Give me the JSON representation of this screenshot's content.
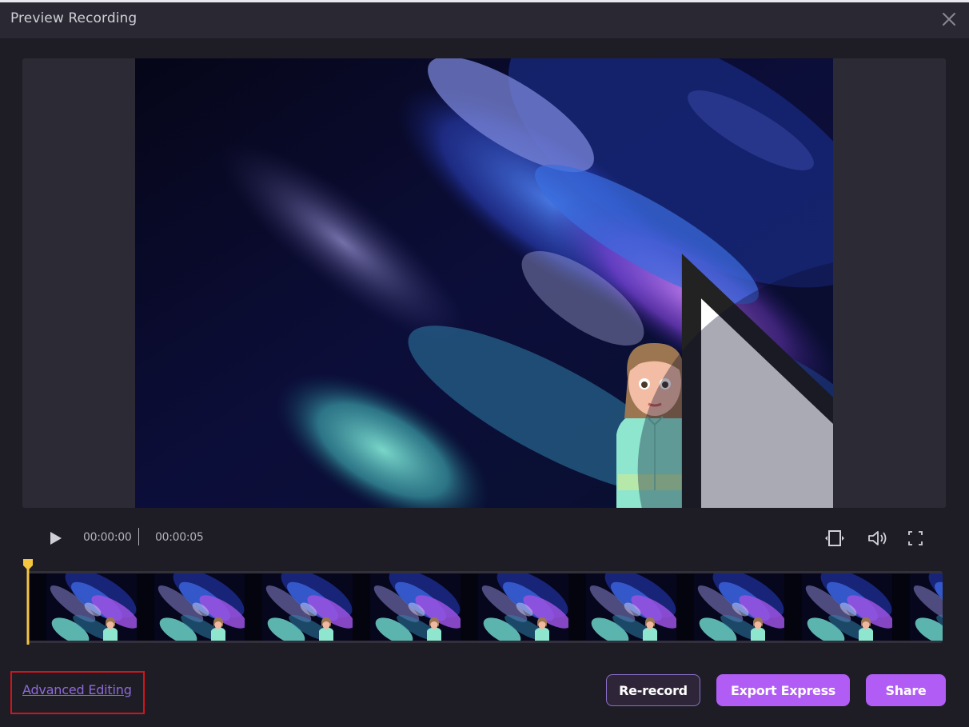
{
  "window": {
    "title": "Preview Recording",
    "close_icon": "close-icon"
  },
  "player": {
    "center_play_icon": "play-icon",
    "current_time": "00:00:00",
    "total_time": "00:00:05",
    "progress_fraction": 0.0,
    "controls": {
      "play_icon": "play-icon",
      "fit_icon": "fit-to-frame-icon",
      "volume_icon": "volume-icon",
      "fullscreen_icon": "fullscreen-icon"
    }
  },
  "timeline": {
    "frame_count": 9,
    "playhead_position_fraction": 0.0,
    "playhead_color": "#f5c542"
  },
  "footer": {
    "advanced_editing_label": "Advanced Editing",
    "rerecord_label": "Re-record",
    "export_label": "Export Express",
    "share_label": "Share"
  },
  "colors": {
    "accent": "#b05cf5",
    "link": "#8e6ad8",
    "highlight_box": "#d4141c",
    "background": "#1e1d25",
    "titlebar": "#2a2933"
  }
}
